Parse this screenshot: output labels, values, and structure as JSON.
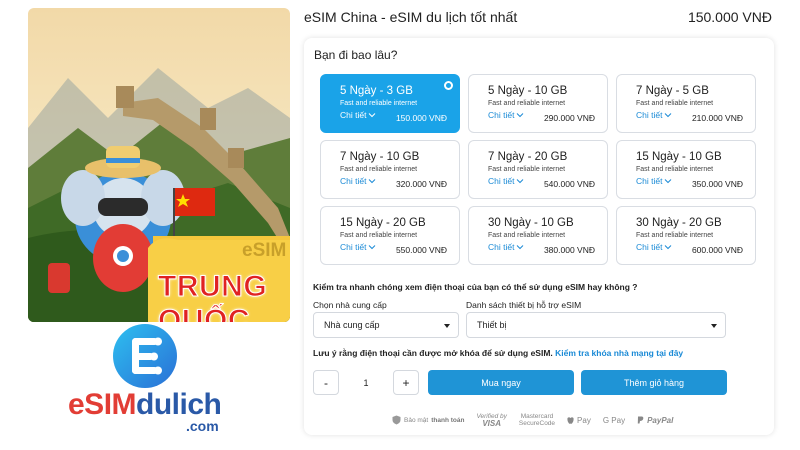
{
  "product": {
    "title": "eSIM China - eSIM du lịch tốt nhất",
    "price": "150.000 VNĐ",
    "image_badge": "eSIM",
    "image_country": "TRUNG QUỐC"
  },
  "brand": {
    "name_part1": "eSIM",
    "name_part2": "dulich",
    "domain": ".com"
  },
  "duration_question": "Bạn đi bao lâu?",
  "plans": [
    {
      "name": "5 Ngày - 3 GB",
      "desc": "Fast and reliable internet",
      "detail": "Chi tiết",
      "price": "150.000 VNĐ",
      "selected": true
    },
    {
      "name": "5 Ngày - 10 GB",
      "desc": "Fast and reliable internet",
      "detail": "Chi tiết",
      "price": "290.000 VNĐ",
      "selected": false
    },
    {
      "name": "7 Ngày - 5 GB",
      "desc": "Fast and reliable internet",
      "detail": "Chi tiết",
      "price": "210.000 VNĐ",
      "selected": false
    },
    {
      "name": "7 Ngày - 10 GB",
      "desc": "Fast and reliable internet",
      "detail": "Chi tiết",
      "price": "320.000 VNĐ",
      "selected": false
    },
    {
      "name": "7 Ngày - 20 GB",
      "desc": "Fast and reliable internet",
      "detail": "Chi tiết",
      "price": "540.000 VNĐ",
      "selected": false
    },
    {
      "name": "15 Ngày - 10 GB",
      "desc": "Fast and reliable internet",
      "detail": "Chi tiết",
      "price": "350.000 VNĐ",
      "selected": false
    },
    {
      "name": "15 Ngày - 20 GB",
      "desc": "Fast and reliable internet",
      "detail": "Chi tiết",
      "price": "550.000 VNĐ",
      "selected": false
    },
    {
      "name": "30 Ngày - 10 GB",
      "desc": "Fast and reliable internet",
      "detail": "Chi tiết",
      "price": "380.000 VNĐ",
      "selected": false
    },
    {
      "name": "30 Ngày - 20 GB",
      "desc": "Fast and reliable internet",
      "detail": "Chi tiết",
      "price": "600.000 VNĐ",
      "selected": false
    }
  ],
  "compat": {
    "question": "Kiểm tra nhanh chóng xem điện thoại của bạn có thể sử dụng eSIM hay không ?",
    "provider_label": "Chọn nhà cung cấp",
    "provider_value": "Nhà cung cấp",
    "device_label": "Danh sách thiết bị hỗ trợ eSIM",
    "device_value": "Thiết bị"
  },
  "unlock": {
    "note": "Lưu ý rằng điện thoại cần được mở khóa để sử dụng eSIM.",
    "link": "Kiểm tra khóa nhà mạng tại đây"
  },
  "quantity": {
    "minus": "-",
    "value": "1",
    "plus": "+"
  },
  "actions": {
    "buy": "Mua ngay",
    "cart": "Thêm giỏ hàng"
  },
  "payment": {
    "secure_prefix": "Bảo mật",
    "secure_strong": "thanh toán",
    "verified_top": "Verified by",
    "verified_bottom": "VISA",
    "mastercard_top": "Mastercard",
    "mastercard_bottom": "SecureCode",
    "applepay": "Pay",
    "gpay": "G Pay",
    "paypal": "PayPal"
  },
  "colors": {
    "accent": "#1aa3e8",
    "button": "#1f94d6",
    "link": "#1a8ad6",
    "brand_red": "#e23d35",
    "brand_blue": "#2a59a7"
  }
}
